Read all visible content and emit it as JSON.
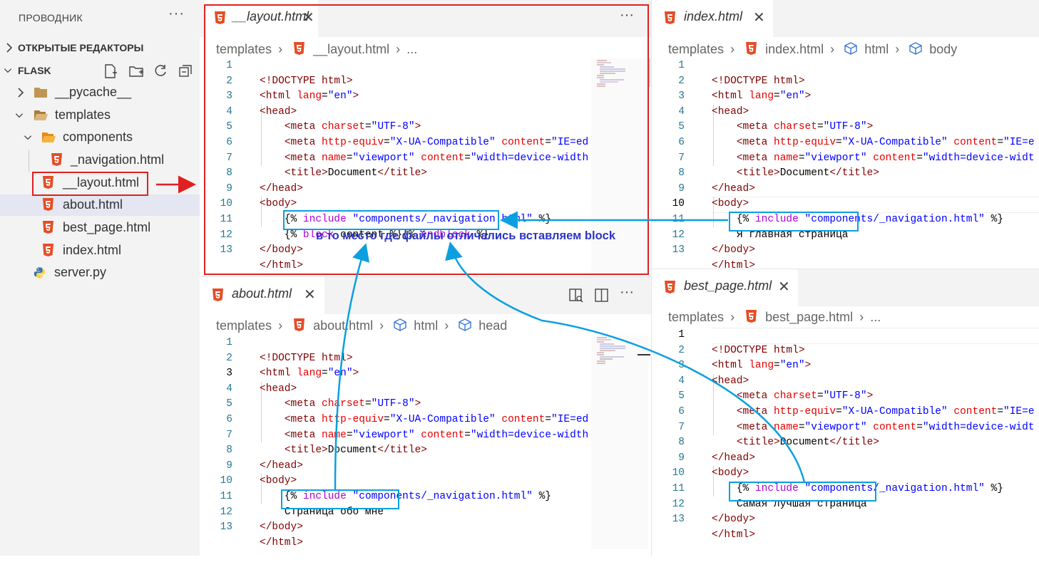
{
  "explorer": {
    "title": "ПРОВОДНИК",
    "more": "···",
    "open_editors": "ОТКРЫТЫЕ РЕДАКТОРЫ",
    "project": "FLASK",
    "tree": {
      "pycache": "__pycache__",
      "templates": "templates",
      "components": "components",
      "navigation": "_navigation.html",
      "layout": "__layout.html",
      "about": "about.html",
      "best_page": "best_page.html",
      "index": "index.html",
      "server": "server.py"
    }
  },
  "editors": {
    "layout": {
      "tab": "__layout.html",
      "breadcrumb": [
        "templates",
        "__layout.html",
        "..."
      ],
      "line_numbers": [
        "1",
        "2",
        "3",
        "4",
        "5",
        "6",
        "7",
        "8",
        "9",
        "10",
        "11",
        "12",
        "13"
      ]
    },
    "index": {
      "tab": "index.html",
      "breadcrumb": [
        "templates",
        "index.html",
        "html",
        "body"
      ],
      "line_numbers": [
        "1",
        "2",
        "3",
        "4",
        "5",
        "6",
        "7",
        "8",
        "9",
        "10",
        "11",
        "12",
        "13"
      ],
      "line11_text": "Я главная страница"
    },
    "about": {
      "tab": "about.html",
      "breadcrumb": [
        "templates",
        "about.html",
        "html",
        "head"
      ],
      "line_numbers": [
        "1",
        "2",
        "3",
        "4",
        "5",
        "6",
        "7",
        "8",
        "9",
        "10",
        "11",
        "12",
        "13"
      ],
      "line11_text": "Страница обо мне"
    },
    "best_page": {
      "tab": "best_page.html",
      "breadcrumb": [
        "templates",
        "best_page.html",
        "..."
      ],
      "line_numbers": [
        "1",
        "2",
        "3",
        "4",
        "5",
        "6",
        "7",
        "8",
        "9",
        "10",
        "11",
        "12",
        "13"
      ],
      "line11_text": "Самая лучшая страница"
    }
  },
  "code": {
    "doctype": "<!DOCTYPE html>",
    "html_open_a": "<html ",
    "lang_attr": "lang",
    "lang_val": "\"en\"",
    "gt": ">",
    "head_open": "<head>",
    "meta": "<meta ",
    "charset_attr": "charset",
    "charset_val": "\"UTF-8\"",
    "httpequiv_attr": "http-equiv",
    "httpequiv_val": "\"X-UA-Compatible\"",
    "content_attr": "content",
    "ie_val_a": "\"IE=ed",
    "ie_val_b": "\"IE=e",
    "name_attr": "name",
    "viewport_val": "\"viewport\"",
    "width_val_a": "\"width=device-width",
    "width_val_b": "\"width=device-widt",
    "eq": "=",
    "title_open": "<title>",
    "title_text": "Document",
    "title_close": "</title>",
    "head_close": "</head>",
    "body_open": "<body>",
    "tpl_open": "{% ",
    "include": "include",
    "nav_path": "\"components/_navigation.html\"",
    "tpl_close": " %}",
    "block": "block",
    "block_mid": " content %}{% ",
    "endblock": "endblock",
    "tpl_open_nospace": "{%",
    "body_close": "</body>",
    "html_close": "</html>"
  },
  "annotation": "в то место где файлы отличались вставляем block",
  "colors": {
    "annotation_blue": "#2b35c4",
    "arrow_blue": "#0aa0e0",
    "red": "#e02020"
  }
}
